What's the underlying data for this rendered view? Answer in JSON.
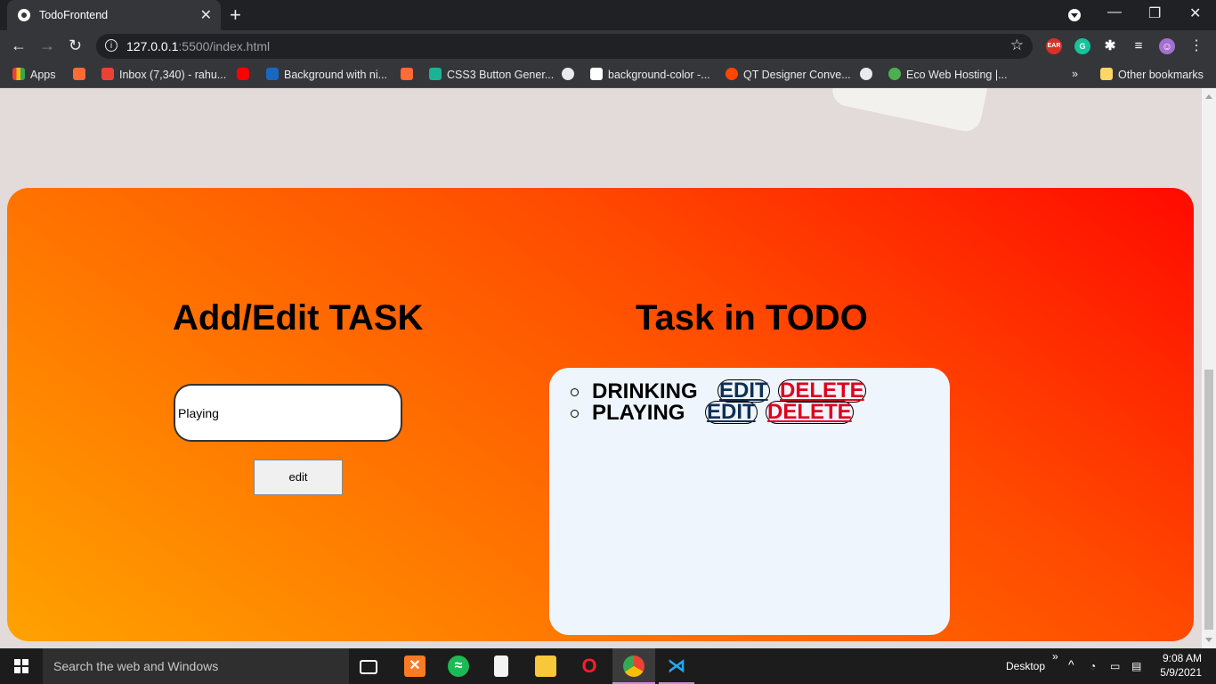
{
  "browser": {
    "tab_title": "TodoFrontend",
    "url_host": "127.0.0.1",
    "url_path": ":5500/index.html",
    "window_buttons": {
      "minimize": "—",
      "restore": "❐",
      "close": "✕"
    },
    "extensions": [
      {
        "name": "ear-icon",
        "label": "EAR",
        "color": "#d93025"
      },
      {
        "name": "grammarly-icon",
        "label": "G",
        "color": "#15c39a"
      },
      {
        "name": "puzzle-icon",
        "label": "✱",
        "color": "#35363a"
      },
      {
        "name": "media-icon",
        "label": "≡",
        "color": "#35363a"
      },
      {
        "name": "profile-avatar",
        "label": "☺",
        "color": "#a56fd1"
      }
    ],
    "bookmarks": [
      {
        "label": "Apps",
        "icon": "apps-grid-icon",
        "color": "#e8a13a"
      },
      {
        "label": "",
        "icon": "bookmark-app-icon",
        "color": "#ff6b35"
      },
      {
        "label": "Inbox (7,340) - rahu...",
        "icon": "gmail-icon",
        "color": "#ea4335"
      },
      {
        "label": "",
        "icon": "youtube-icon",
        "color": "#ff0000"
      },
      {
        "label": "Background with ni...",
        "icon": "vuetify-icon",
        "color": "#1867c0"
      },
      {
        "label": "",
        "icon": "bookmark-app-icon",
        "color": "#ff6b35"
      },
      {
        "label": "CSS3 Button Gener...",
        "icon": "download-icon",
        "color": "#1ab394"
      },
      {
        "label": "",
        "icon": "globe-icon",
        "color": "#e8eaed"
      },
      {
        "label": "background-color -...",
        "icon": "codepen-icon",
        "color": "#ffffff"
      },
      {
        "label": "QT Designer Conve...",
        "icon": "reddit-icon",
        "color": "#ff4500"
      },
      {
        "label": "",
        "icon": "globe-icon",
        "color": "#e8eaed"
      },
      {
        "label": "Eco Web Hosting |...",
        "icon": "leaf-icon",
        "color": "#4caf50"
      }
    ],
    "bookmarks_overflow": "»",
    "other_bookmarks": "Other bookmarks"
  },
  "page": {
    "add_heading": "Add/Edit TASK",
    "task_heading": "Task in TODO",
    "input_value": "Playing",
    "edit_button": "edit",
    "tasks": [
      {
        "name": "DRINKING",
        "edit": "EDIT",
        "delete": "DELETE"
      },
      {
        "name": "PLAYING",
        "edit": "EDIT",
        "delete": "DELETE"
      }
    ]
  },
  "taskbar": {
    "search_placeholder": "Search the web and Windows",
    "desktop_label": "Desktop",
    "overflow": "»",
    "time": "9:08 AM",
    "date": "5/9/2021"
  },
  "colors": {
    "gradient_start": "#ffa200",
    "gradient_end": "#ff0a00",
    "delete_text": "#e0001a",
    "edit_text": "#0f2f55"
  }
}
